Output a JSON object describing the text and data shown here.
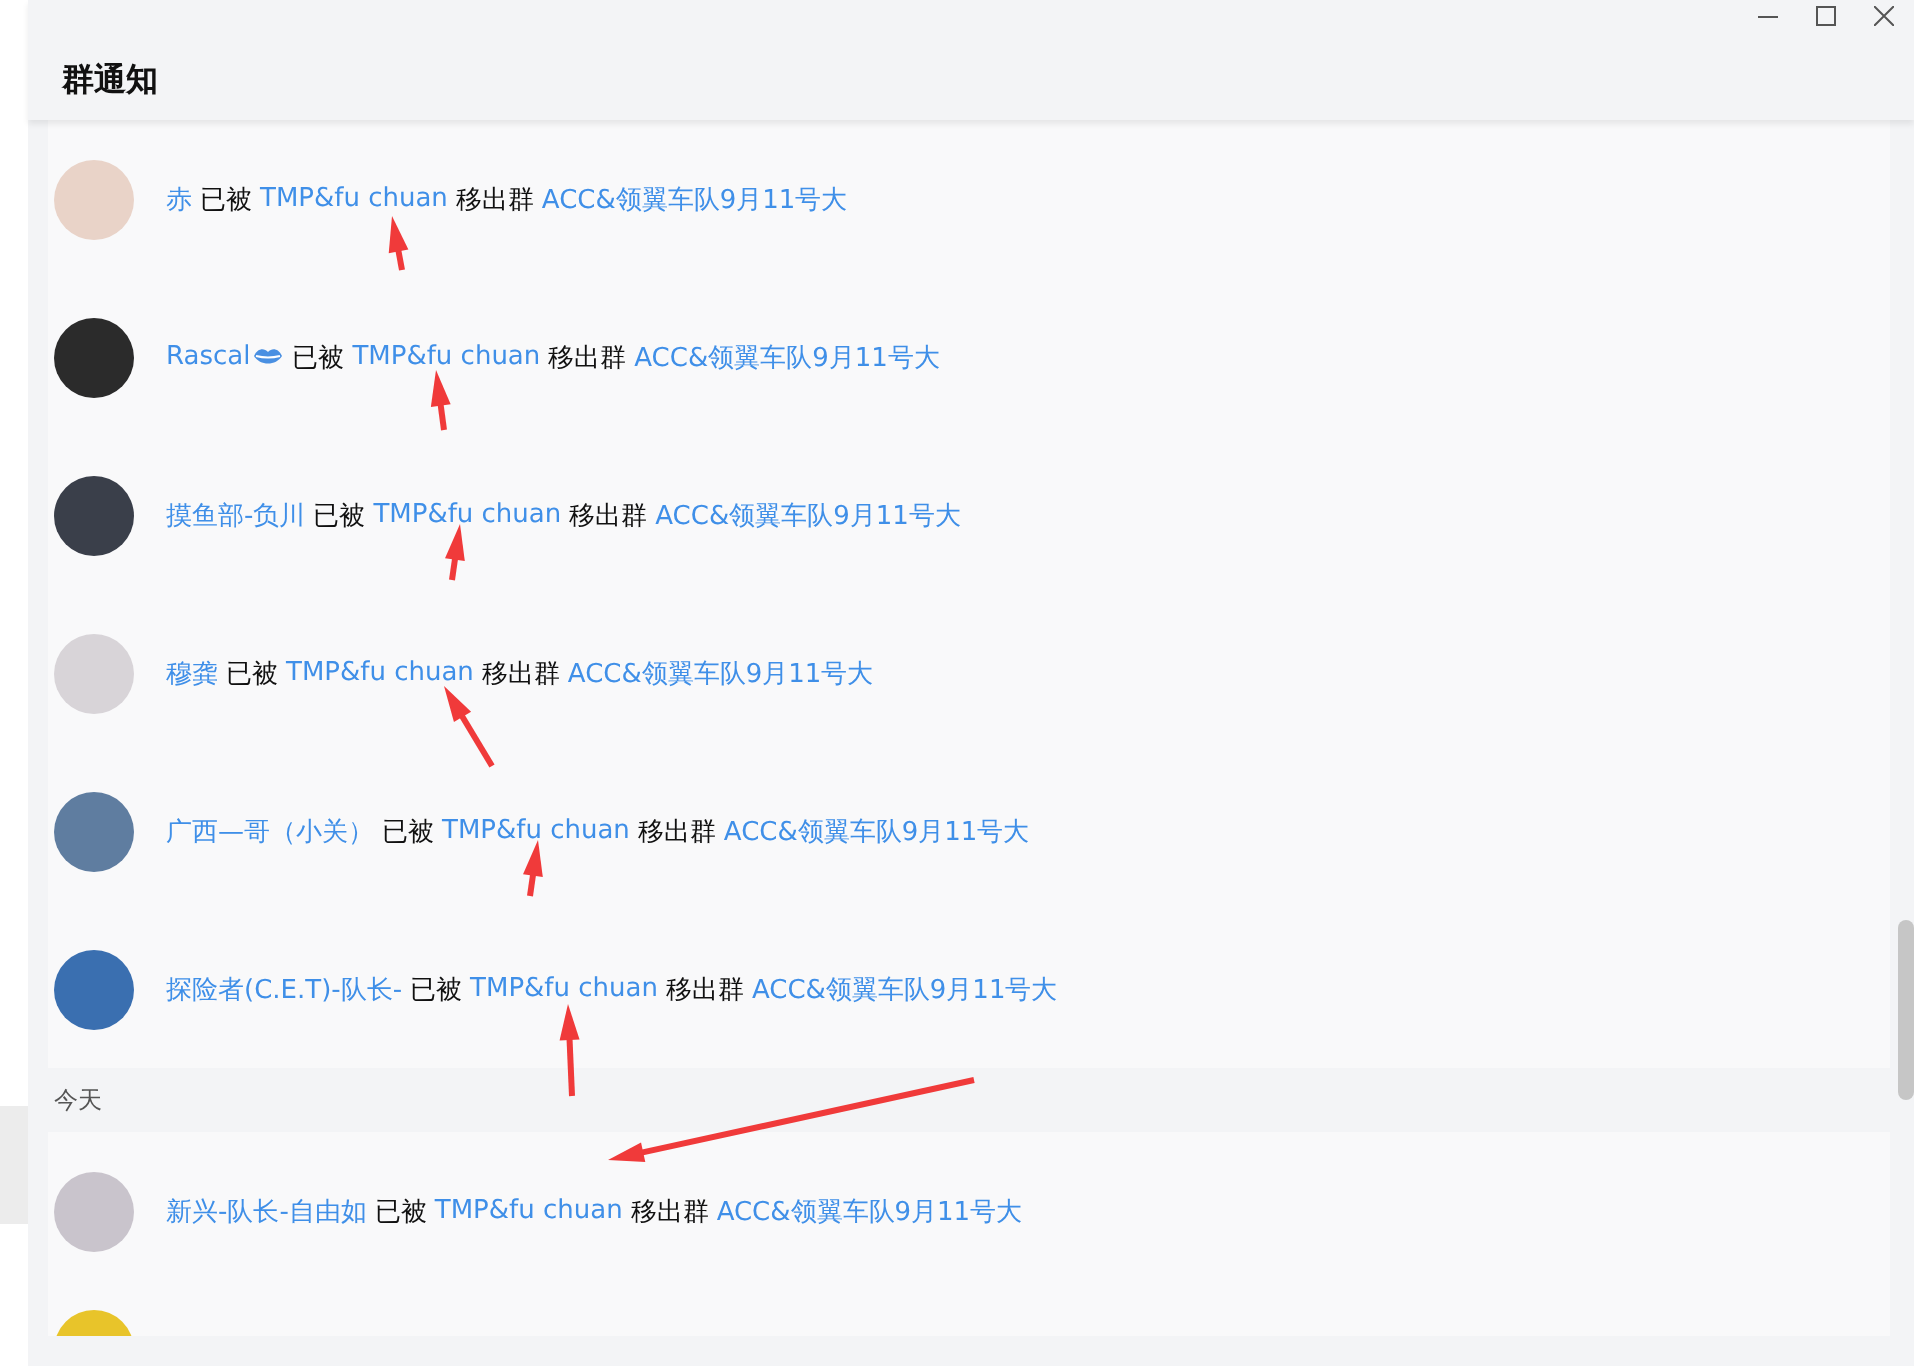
{
  "window": {
    "title": "群通知"
  },
  "groups": [
    {
      "rows": [
        {
          "member": "赤",
          "kind": "plain",
          "verb": "已被",
          "operator": "TMP&fu chuan",
          "action": "移出群",
          "group": "ACC&领翼车队9月11号大"
        },
        {
          "member": "Rascal",
          "kind": "badge",
          "verb": "已被",
          "operator": "TMP&fu chuan",
          "action": "移出群",
          "group": "ACC&领翼车队9月11号大"
        },
        {
          "member": "摸鱼部-负川",
          "kind": "plain",
          "verb": "已被",
          "operator": "TMP&fu chuan",
          "action": "移出群",
          "group": "ACC&领翼车队9月11号大"
        },
        {
          "member": "穆龚",
          "kind": "plain",
          "verb": "已被",
          "operator": "TMP&fu chuan",
          "action": "移出群",
          "group": "ACC&领翼车队9月11号大"
        },
        {
          "member": "广西—哥（小关）",
          "kind": "plain",
          "verb": "已被",
          "operator": "TMP&fu chuan",
          "action": "移出群",
          "group": "ACC&领翼车队9月11号大"
        },
        {
          "member": "探险者(C.E.T)-队长-",
          "kind": "plain",
          "verb": "已被",
          "operator": "TMP&fu chuan",
          "action": "移出群",
          "group": "ACC&领翼车队9月11号大"
        }
      ]
    },
    {
      "label": "今天",
      "rows": [
        {
          "member": "新兴-队长-自由如",
          "kind": "plain",
          "verb": "已被",
          "operator": "TMP&fu chuan",
          "action": "移出群",
          "group": "ACC&领翼车队9月11号大"
        }
      ]
    }
  ]
}
